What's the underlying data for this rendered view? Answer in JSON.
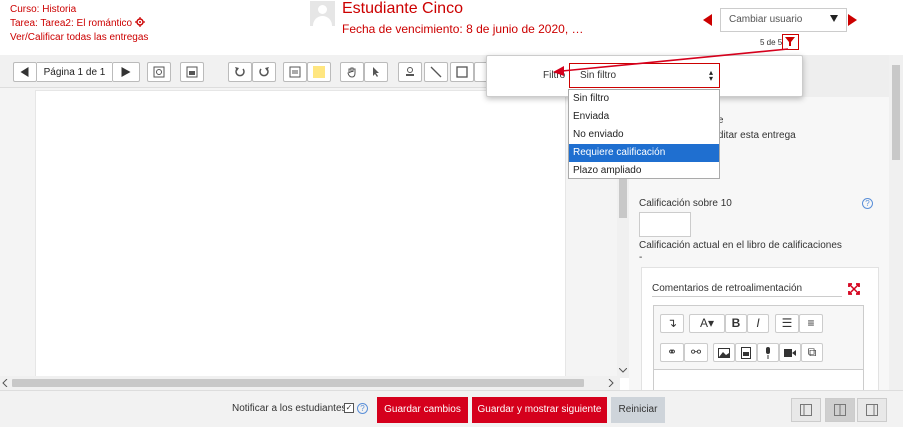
{
  "header": {
    "course_label": "Curso: Historia",
    "assignment_label": "Tarea: Tarea2: El romántico",
    "view_all_link": "Ver/Calificar todas las entregas",
    "student_name": "Estudiante Cinco",
    "due_date": "Fecha de vencimiento: 8 de junio de 2020, …",
    "change_user_placeholder": "Cambiar usuario",
    "count_text": "5 de 5"
  },
  "toolbar": {
    "page_label": "Página 1 de 1"
  },
  "filter": {
    "label": "Filtro",
    "selected": "Sin filtro",
    "options": [
      {
        "label": "Sin filtro"
      },
      {
        "label": "Enviada"
      },
      {
        "label": "No enviado"
      },
      {
        "label": "Requiere calificación"
      },
      {
        "label": "Plazo ampliado"
      }
    ],
    "highlighted_index": 3
  },
  "grading": {
    "partial_line1": "ante",
    "partial_line2": "e editar esta entrega",
    "grade_out_of": "Calificación sobre 10",
    "gradebook_label": "Calificación actual en el libro de calificaciones",
    "gradebook_value": "-",
    "feedback_title": "Comentarios de retroalimentación"
  },
  "bottom": {
    "notify_label": "Notificar a los estudiantes",
    "save_label": "Guardar cambios",
    "save_next_label": "Guardar y mostrar siguiente",
    "reset_label": "Reiniciar"
  },
  "colors": {
    "brand_red": "#d5001c",
    "highlight_blue": "#1f6fd0"
  }
}
